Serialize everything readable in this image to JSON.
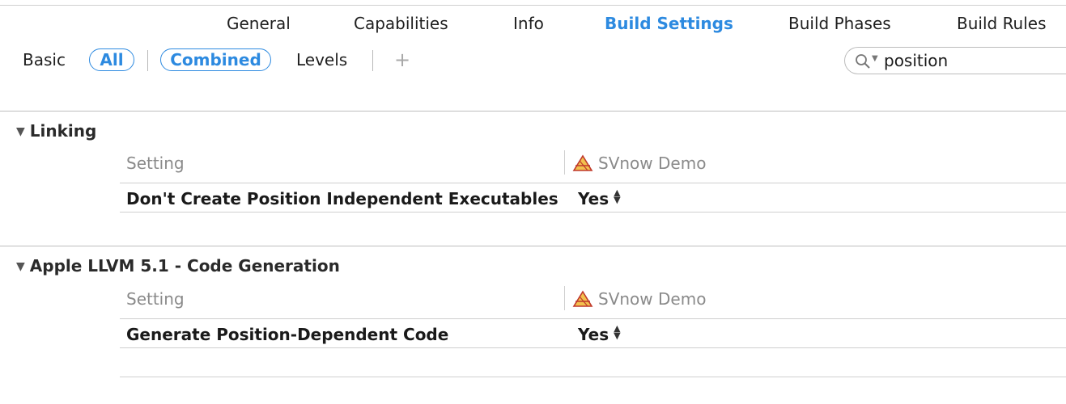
{
  "tabs": [
    {
      "label": "General",
      "active": false
    },
    {
      "label": "Capabilities",
      "active": false
    },
    {
      "label": "Info",
      "active": false
    },
    {
      "label": "Build Settings",
      "active": true
    },
    {
      "label": "Build Phases",
      "active": false
    },
    {
      "label": "Build Rules",
      "active": false
    }
  ],
  "filters": {
    "basic": "Basic",
    "all": "All",
    "combined": "Combined",
    "levels": "Levels",
    "add": "+"
  },
  "search": {
    "value": "position",
    "icon": "magnifier-icon"
  },
  "sections": [
    {
      "title": "Linking",
      "column_setting": "Setting",
      "target": "SVnow Demo",
      "rows": [
        {
          "name": "Don't Create Position Independent Executables",
          "value": "Yes"
        }
      ]
    },
    {
      "title": "Apple LLVM 5.1 - Code Generation",
      "column_setting": "Setting",
      "target": "SVnow Demo",
      "rows": [
        {
          "name": "Generate Position-Dependent Code",
          "value": "Yes"
        }
      ]
    }
  ],
  "colors": {
    "accent": "#2d8ae0",
    "muted": "#8a8a8a",
    "divider": "#cfcfcf"
  }
}
